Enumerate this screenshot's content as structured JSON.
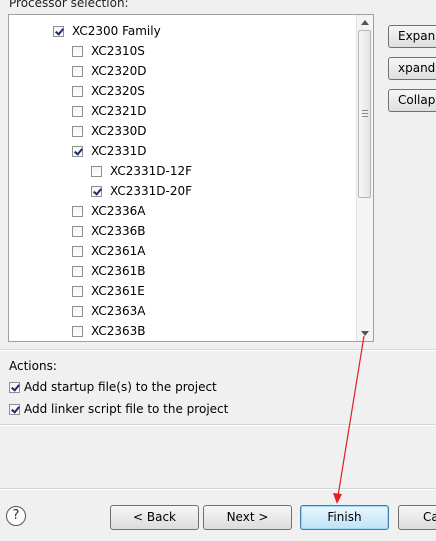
{
  "processor_selection": {
    "label": "Processor selection:",
    "items": [
      {
        "label": "XC2300 Family",
        "checked": true,
        "level": 0
      },
      {
        "label": "XC2310S",
        "checked": false,
        "level": 1
      },
      {
        "label": "XC2320D",
        "checked": false,
        "level": 1
      },
      {
        "label": "XC2320S",
        "checked": false,
        "level": 1
      },
      {
        "label": "XC2321D",
        "checked": false,
        "level": 1
      },
      {
        "label": "XC2330D",
        "checked": false,
        "level": 1
      },
      {
        "label": "XC2331D",
        "checked": true,
        "level": 1
      },
      {
        "label": "XC2331D-12F",
        "checked": false,
        "level": 2
      },
      {
        "label": "XC2331D-20F",
        "checked": true,
        "level": 2
      },
      {
        "label": "XC2336A",
        "checked": false,
        "level": 1
      },
      {
        "label": "XC2336B",
        "checked": false,
        "level": 1
      },
      {
        "label": "XC2361A",
        "checked": false,
        "level": 1
      },
      {
        "label": "XC2361B",
        "checked": false,
        "level": 1
      },
      {
        "label": "XC2361E",
        "checked": false,
        "level": 1
      },
      {
        "label": "XC2363A",
        "checked": false,
        "level": 1
      },
      {
        "label": "XC2363B",
        "checked": false,
        "level": 1
      }
    ],
    "side_buttons": {
      "expand_all": "Expan",
      "expand_selected": "xpand S",
      "collapse": "Collap"
    }
  },
  "actions": {
    "label": "Actions:",
    "items": [
      {
        "label": "Add startup file(s) to the project",
        "checked": true
      },
      {
        "label": "Add linker script file to the project",
        "checked": true
      }
    ]
  },
  "footer": {
    "help": "?",
    "back": "< Back",
    "next": "Next >",
    "finish": "Finish",
    "cancel": "Ca"
  },
  "colors": {
    "annotation_arrow": "#e02020"
  }
}
